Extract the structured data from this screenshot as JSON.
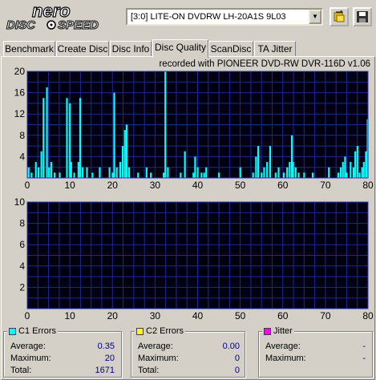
{
  "app": {
    "logo_line1": "nero",
    "logo_line2": "DISC",
    "logo_line3": "SPEED"
  },
  "toolbar": {
    "drive": "[3:0]   LITE-ON DVDRW LH-20A1S 9L03",
    "swap_icon": "swap-drive-icon",
    "save_icon": "floppy-save-icon"
  },
  "tabs": [
    {
      "label": "Benchmark"
    },
    {
      "label": "Create Disc"
    },
    {
      "label": "Disc Info"
    },
    {
      "label": "Disc Quality"
    },
    {
      "label": "ScanDisc"
    },
    {
      "label": "TA Jitter"
    }
  ],
  "active_tab": "Disc Quality",
  "recorded_with": "recorded with PIONEER DVD-RW  DVR-116D v1.06",
  "stats": {
    "c1": {
      "title": "C1 Errors",
      "color": "#00ffff",
      "average_label": "Average:",
      "average": "0.35",
      "maximum_label": "Maximum:",
      "maximum": "20",
      "total_label": "Total:",
      "total": "1671"
    },
    "c2": {
      "title": "C2 Errors",
      "color": "#ffff00",
      "average_label": "Average:",
      "average": "0.00",
      "maximum_label": "Maximum:",
      "maximum": "0",
      "total_label": "Total:",
      "total": "0"
    },
    "jitter": {
      "title": "Jitter",
      "color": "#ff00ff",
      "average_label": "Average:",
      "average": "-",
      "maximum_label": "Maximum:",
      "maximum": "-"
    }
  },
  "chart_data": [
    {
      "type": "bar",
      "name": "C1 Errors",
      "color": "#00ffff",
      "xlim": [
        0,
        80
      ],
      "ylim": [
        0,
        20
      ],
      "x_ticks": [
        0,
        10,
        20,
        30,
        40,
        50,
        60,
        70,
        80
      ],
      "y_ticks": [
        4,
        8,
        12,
        16,
        20
      ],
      "grid": true,
      "x": [
        0.3,
        1,
        2,
        2.6,
        3.3,
        3.8,
        4.6,
        5.1,
        5.6,
        6.4,
        7.6,
        9.3,
        10,
        10.3,
        11,
        12,
        12.4,
        13,
        14,
        15.3,
        17,
        19.3,
        20,
        20.4,
        21,
        21.8,
        22.4,
        22.9,
        23.3,
        23.9,
        26,
        28,
        29,
        32,
        32.4,
        33,
        36,
        37,
        39,
        39.4,
        40,
        40.9,
        41.5,
        42,
        45,
        50,
        53,
        53.7,
        54.2,
        55,
        55.6,
        56.3,
        57,
        58.3,
        59,
        60.2,
        61,
        61.6,
        62.1,
        62.4,
        63,
        63.7,
        65,
        67,
        70.8,
        73,
        73.6,
        74.1,
        74.6,
        75,
        75.9,
        76.6,
        77,
        77.5,
        78,
        78.6,
        79,
        79.5,
        79.9
      ],
      "values": [
        2,
        1,
        3,
        2,
        5,
        15,
        17,
        2,
        3,
        1,
        1,
        15,
        14,
        3,
        1,
        3,
        15,
        2,
        2,
        1,
        2,
        2,
        1,
        16,
        2,
        3,
        6,
        9,
        10,
        2,
        1,
        2,
        1,
        1,
        20,
        2,
        1,
        5,
        1,
        4,
        2,
        1,
        1,
        2,
        1,
        2,
        1,
        4,
        6,
        1,
        2,
        3,
        6,
        1,
        2,
        1,
        2,
        3,
        8,
        3,
        2,
        1,
        1,
        1,
        2,
        1,
        2,
        3,
        4,
        1,
        3,
        2,
        5,
        6,
        1,
        2,
        3,
        5,
        11
      ]
    },
    {
      "type": "bar",
      "name": "C2 Errors",
      "color": "#ffff00",
      "xlim": [
        0,
        80
      ],
      "ylim": [
        0,
        10
      ],
      "x_ticks": [
        0,
        10,
        20,
        30,
        40,
        50,
        60,
        70,
        80
      ],
      "y_ticks": [
        2,
        4,
        6,
        8,
        10
      ],
      "grid": true,
      "x": [],
      "values": []
    }
  ]
}
